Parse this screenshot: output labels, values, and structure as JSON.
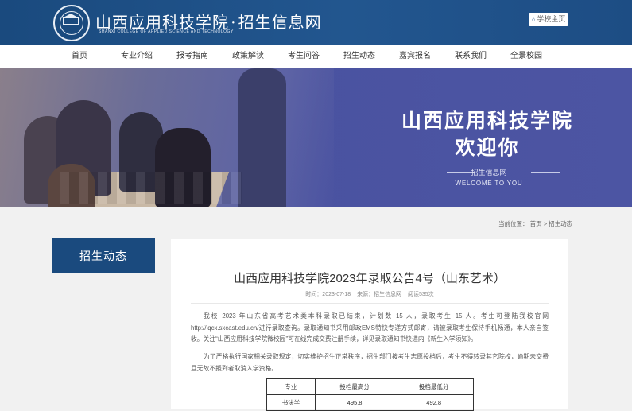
{
  "header": {
    "brand_cn": "山西应用科技学院",
    "brand_dot": "·",
    "brand_sub": "招生信息网",
    "brand_en": "SHANXI COLLEGE OF APPLIED SCIENCE AND TECHNOLOGY",
    "home_icon": "home-icon",
    "home_label": "学校主页",
    "color": "#1a4a7e"
  },
  "nav": {
    "items": [
      "首页",
      "专业介绍",
      "报考指南",
      "政策解读",
      "考生问答",
      "招生动态",
      "嘉宾报名",
      "联系我们",
      "全景校园"
    ]
  },
  "banner": {
    "title": "山西应用科技学院",
    "welcome": "欢迎你",
    "sub": "招生信息网",
    "en": "WELCOME TO YOU"
  },
  "breadcrumb": {
    "prefix": "当前位置：",
    "home": "首页",
    "sep": ">",
    "current": "招生动态"
  },
  "sidebar": {
    "title": "招生动态"
  },
  "article": {
    "title": "山西应用科技学院2023年录取公告4号（山东艺术）",
    "time": "时间：2023-07-18",
    "source": "来源：招生信息网",
    "views": "阅读535次",
    "para1": "我校 2023 年山东省高考艺术类本科录取已结束，计划数 15 人，录取考生 15 人。考生可登陆我校官网 http://lqcx.sxcast.edu.cn/进行录取查询。录取通知书采用邮政EMS特快专递方式邮寄，请被录取考生保持手机畅通，本人亲自签收。关注“山西应用科技学院微校园”可在线完成交费注册手续，详见录取通知书快递内《新生入学须知》。",
    "para2": "为了严格执行国家相关录取规定，切实维护招生正常秩序，招生部门按考生志愿投档后，考生不得转录其它院校，逾期未交费且无故不报到者取消入学资格。",
    "table": {
      "headers": [
        "专业",
        "投档最高分",
        "投档最低分"
      ],
      "rows": [
        [
          "书法学",
          "495.8",
          "492.8"
        ]
      ]
    }
  }
}
